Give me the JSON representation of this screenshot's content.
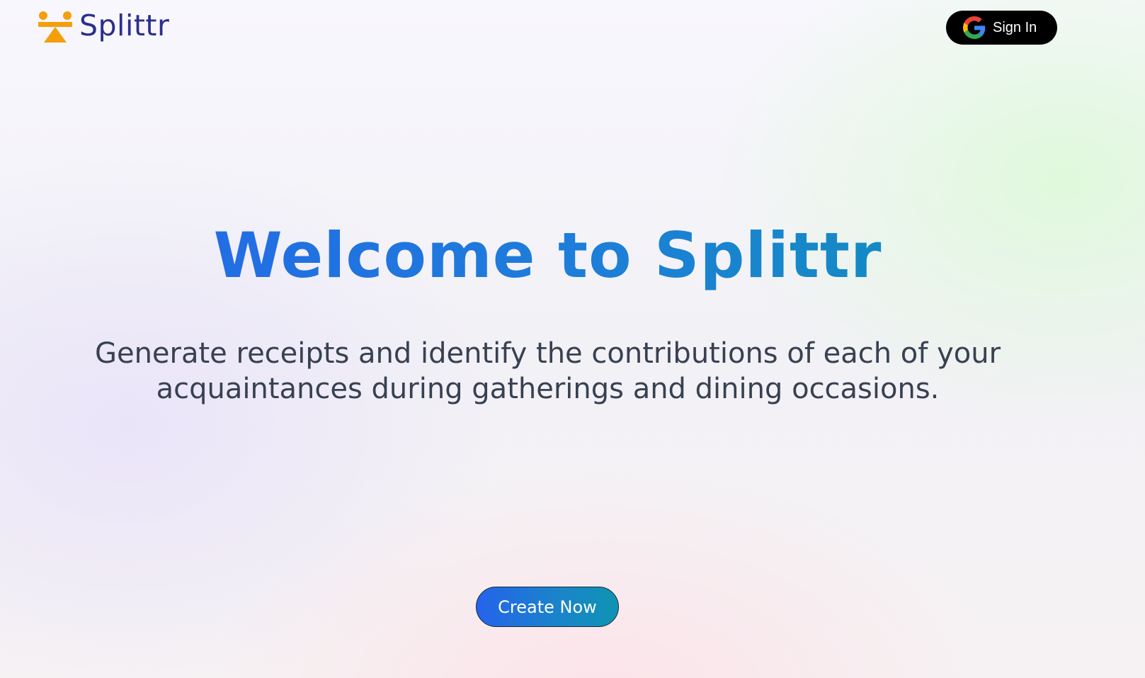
{
  "header": {
    "brand_name": "Splittr",
    "logo_icon": "splittr-logo-icon",
    "signin": {
      "label": "Sign In",
      "icon": "google-icon"
    }
  },
  "hero": {
    "title": "Welcome to Splittr",
    "subtitle": "Generate receipts and identify the contributions of each of your acquaintances during gatherings and dining occasions.",
    "cta_label": "Create Now"
  },
  "colors": {
    "brand_navy": "#2c2e8c",
    "logo_orange": "#f59e0b",
    "title_gradient_start": "#2563eb",
    "title_gradient_end": "#0e92b4",
    "signin_bg": "#000000",
    "subtitle_text": "#374151"
  }
}
